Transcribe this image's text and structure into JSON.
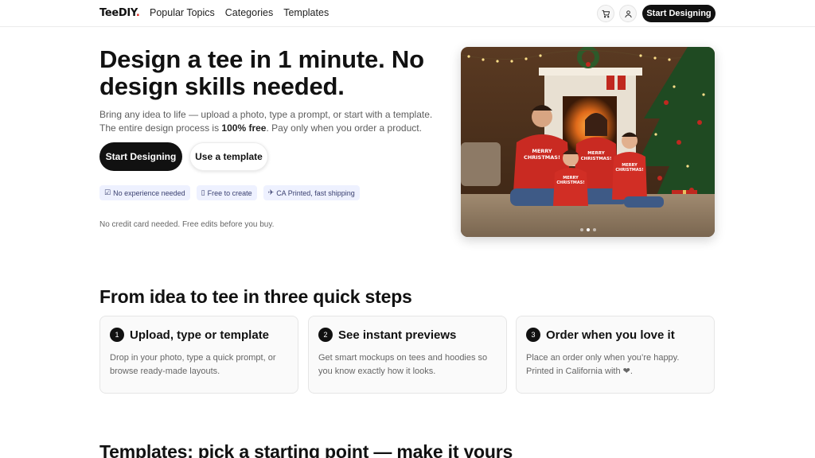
{
  "header": {
    "logo": "TeeDIY",
    "logo_dot": ".",
    "nav": [
      "Popular Topics",
      "Categories",
      "Templates"
    ],
    "cta": "Start Designing",
    "icons": [
      "cart-icon",
      "user-icon"
    ]
  },
  "hero": {
    "title": "Design a tee in 1 minute. No design skills needed.",
    "subtitle_pre": "Bring any idea to life — upload a photo, type a prompt, or start with a template. The entire design process is ",
    "subtitle_bold": "100% free",
    "subtitle_post": ". Pay only when you order a product.",
    "primary_button": "Start Designing",
    "secondary_button": "Use a template",
    "chips": [
      {
        "icon": "☑",
        "icon_name": "checkbox-icon",
        "label": "No experience needed"
      },
      {
        "icon": "▯",
        "icon_name": "free-icon",
        "label": "Free to create"
      },
      {
        "icon": "✈",
        "icon_name": "plane-icon",
        "label": "CA Printed, fast shipping"
      }
    ],
    "note": "No credit card needed. Free edits before you buy.",
    "image": {
      "shirt_text": [
        "MERRY",
        "CHRISTMAS!"
      ],
      "carousel_count": 3,
      "carousel_active": 1
    }
  },
  "steps": {
    "title": "From idea to tee in three quick steps",
    "items": [
      {
        "num": "1",
        "title": "Upload, type or template",
        "desc": "Drop in your photo, type a quick prompt, or browse ready-made layouts."
      },
      {
        "num": "2",
        "title": "See instant previews",
        "desc": "Get smart mockups on tees and hoodies so you know exactly how it looks."
      },
      {
        "num": "3",
        "title": "Order when you love it",
        "desc": "Place an order only when you’re happy. Printed in California with ❤."
      }
    ]
  },
  "templates": {
    "title": "Templates: pick a starting point — make it yours"
  },
  "colors": {
    "primary": "#111111",
    "chip_bg": "#eef1ff",
    "chip_text": "#3b4170",
    "logo_accent": "#e0261d"
  }
}
